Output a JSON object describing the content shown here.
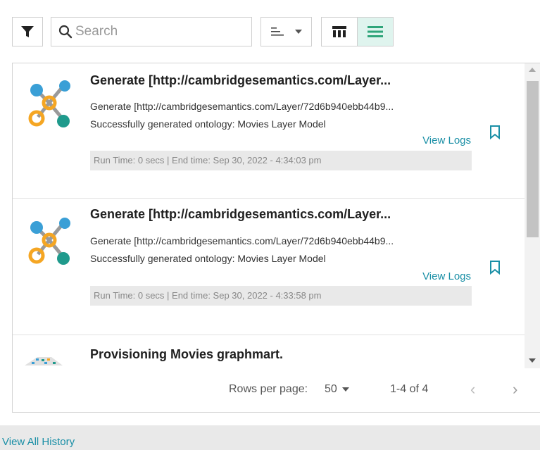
{
  "toolbar": {
    "filter_icon": "filter-icon",
    "search_placeholder": "Search",
    "search_value": "",
    "sort_icon": "sort-lines-icon",
    "view_grid_icon": "table-view-icon",
    "view_list_icon": "list-view-icon",
    "accent_color": "#3fb68e",
    "active_view_bg": "#dff4ee"
  },
  "items": [
    {
      "icon": "ontology-molecule-icon",
      "title": "Generate [http://cambridgesemantics.com/Layer...",
      "detail": "Generate [http://cambridgesemantics.com/Layer/72d6b940ebb44b9...",
      "status": "Successfully generated ontology: Movies Layer Model",
      "action": "View Logs",
      "meta": "Run Time: 0 secs | End time: Sep 30, 2022 - 4:34:03 pm",
      "bookmark_icon": "bookmark-icon"
    },
    {
      "icon": "ontology-molecule-icon",
      "title": "Generate [http://cambridgesemantics.com/Layer...",
      "detail": "Generate [http://cambridgesemantics.com/Layer/72d6b940ebb44b9...",
      "status": "Successfully generated ontology: Movies Layer Model",
      "action": "View Logs",
      "meta": "Run Time: 0 secs | End time: Sep 30, 2022 - 4:33:58 pm",
      "bookmark_icon": "bookmark-icon"
    },
    {
      "icon": "graphmart-icon",
      "title": "Provisioning Movies graphmart."
    }
  ],
  "pagination": {
    "rows_label": "Rows per page:",
    "rows_value": "50",
    "range": "1-4 of 4",
    "prev": "‹",
    "next": "›"
  },
  "footer": {
    "link": "View All History"
  },
  "colors": {
    "link": "#1a8fa6",
    "molecule_blue": "#3a9fd6",
    "molecule_teal": "#1f9a8c",
    "molecule_orange": "#f5a623"
  }
}
